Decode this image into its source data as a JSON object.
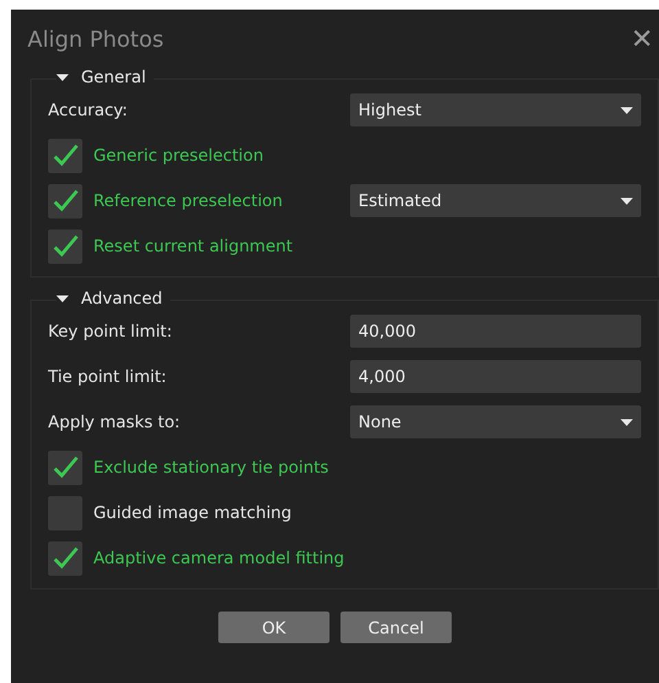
{
  "window": {
    "title": "Align Photos",
    "close": "✕"
  },
  "groups": [
    {
      "title": "General",
      "expanded": true,
      "rows": [
        {
          "kind": "select",
          "label": "Accuracy:",
          "value": "Highest"
        },
        {
          "kind": "checkbox",
          "label": "Generic preselection",
          "checked": true
        },
        {
          "kind": "checkbox",
          "label": "Reference preselection",
          "checked": true,
          "value": "Estimated"
        },
        {
          "kind": "checkbox",
          "label": "Reset current alignment",
          "checked": true
        }
      ]
    },
    {
      "title": "Advanced",
      "expanded": true,
      "rows": [
        {
          "kind": "field",
          "label": "Key point limit:",
          "value": "40,000"
        },
        {
          "kind": "field",
          "label": "Tie point limit:",
          "value": "4,000"
        },
        {
          "kind": "select",
          "label": "Apply masks to:",
          "value": "None"
        },
        {
          "kind": "checkbox",
          "label": "Exclude stationary tie points",
          "checked": true
        },
        {
          "kind": "checkbox",
          "label": "Guided image matching",
          "checked": false
        },
        {
          "kind": "checkbox",
          "label": "Adaptive camera model fitting",
          "checked": true
        }
      ]
    }
  ],
  "buttons": [
    "OK",
    "Cancel"
  ]
}
